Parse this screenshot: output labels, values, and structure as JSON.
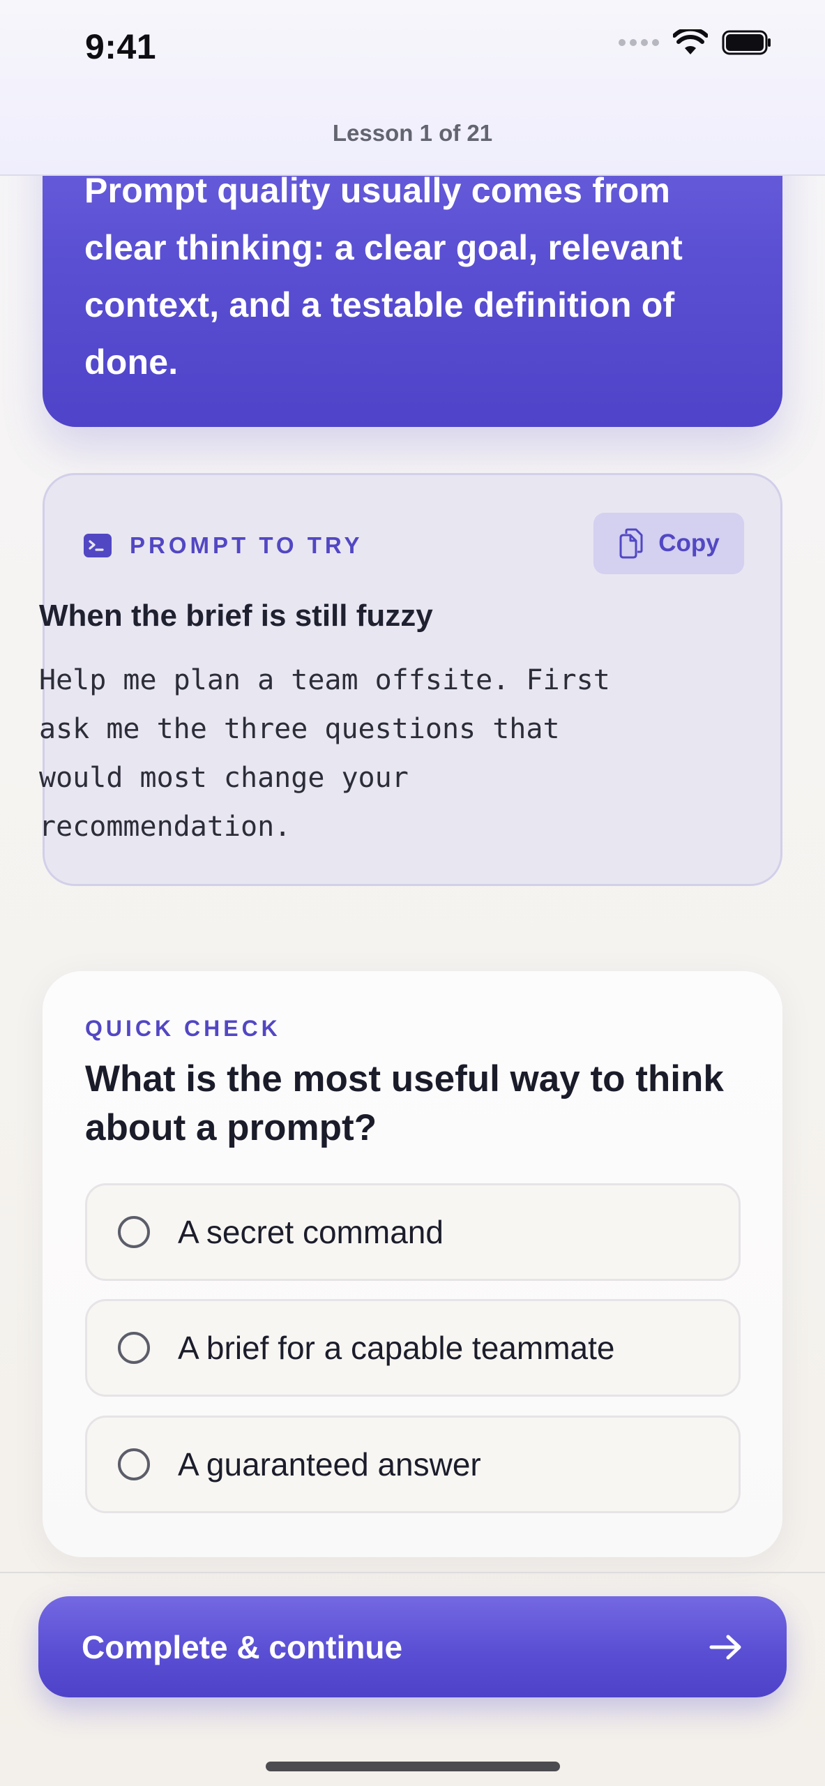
{
  "status_bar": {
    "time": "9:41"
  },
  "header": {
    "lesson_counter": "Lesson 1 of 21"
  },
  "hero": {
    "text": "Prompt quality usually comes from clear thinking: a clear goal, relevant context, and a testable definition of done."
  },
  "prompt_card": {
    "label": "PROMPT TO TRY",
    "copy_label": "Copy",
    "title": "When the brief is still fuzzy",
    "lines": [
      "Help me plan a team offsite. First",
      "ask me the three questions that",
      "would most change your",
      "recommendation."
    ]
  },
  "quiz": {
    "label": "QUICK CHECK",
    "question": "What is the most useful way to think about a prompt?",
    "options": [
      {
        "label": "A secret command"
      },
      {
        "label": "A brief for a capable teammate"
      },
      {
        "label": "A guaranteed answer"
      }
    ]
  },
  "cta": {
    "label": "Complete & continue"
  },
  "colors": {
    "accent": "#5247c3",
    "hero_gradient_top": "#6c63de",
    "hero_gradient_bottom": "#4f43c9"
  }
}
